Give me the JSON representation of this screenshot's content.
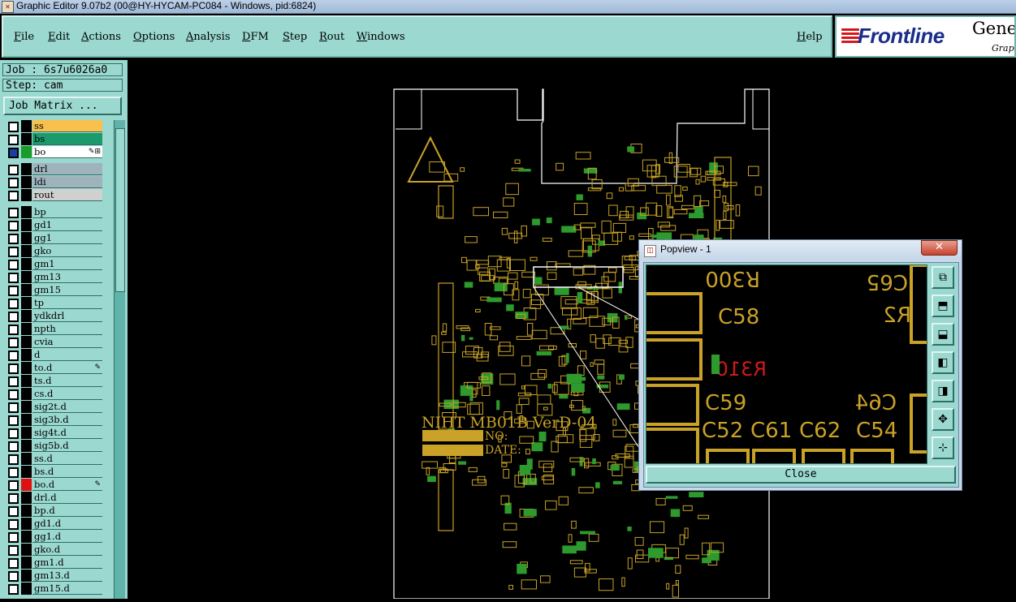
{
  "window": {
    "title": "Graphic Editor 9.07b2 (00@HY-HYCAM-PC084 - Windows, pid:6824)"
  },
  "menu": [
    {
      "label": "File"
    },
    {
      "label": "Edit"
    },
    {
      "label": "Actions"
    },
    {
      "label": "Options"
    },
    {
      "label": "Analysis"
    },
    {
      "label": "DFM"
    },
    {
      "label": "Step"
    },
    {
      "label": "Rout"
    },
    {
      "label": "Windows"
    },
    {
      "label": "Help"
    }
  ],
  "logo": {
    "brand": "Frontline",
    "product_top": "Gene",
    "product_sub": "Grap"
  },
  "job": {
    "job_label": "Job : 6s7u6026a0",
    "step_label": "Step: cam",
    "matrix_button": "Job Matrix ..."
  },
  "layers": [
    {
      "name": "ss",
      "color": "#f9c14c",
      "checked": false,
      "swatch": ""
    },
    {
      "name": "bs",
      "color": "#1c9a6c",
      "checked": false,
      "swatch": ""
    },
    {
      "name": "bo",
      "color": "#ffffff",
      "checked": true,
      "swatch": "#1a9c2a"
    },
    {
      "name": "drl",
      "color": "#9fb3bd",
      "checked": false,
      "swatch": ""
    },
    {
      "name": "ldi",
      "color": "#9fb3bd",
      "checked": false,
      "swatch": ""
    },
    {
      "name": "rout",
      "color": "#d0d0d0",
      "checked": false,
      "swatch": ""
    },
    {
      "name": "bp",
      "color": "#9bd8d0",
      "checked": false,
      "swatch": ""
    },
    {
      "name": "gd1",
      "color": "#9bd8d0",
      "checked": false,
      "swatch": ""
    },
    {
      "name": "gg1",
      "color": "#9bd8d0",
      "checked": false,
      "swatch": ""
    },
    {
      "name": "gko",
      "color": "#9bd8d0",
      "checked": false,
      "swatch": ""
    },
    {
      "name": "gm1",
      "color": "#9bd8d0",
      "checked": false,
      "swatch": ""
    },
    {
      "name": "gm13",
      "color": "#9bd8d0",
      "checked": false,
      "swatch": ""
    },
    {
      "name": "gm15",
      "color": "#9bd8d0",
      "checked": false,
      "swatch": ""
    },
    {
      "name": "tp",
      "color": "#9bd8d0",
      "checked": false,
      "swatch": ""
    },
    {
      "name": "ydkdrl",
      "color": "#9bd8d0",
      "checked": false,
      "swatch": ""
    },
    {
      "name": "npth",
      "color": "#9bd8d0",
      "checked": false,
      "swatch": ""
    },
    {
      "name": "cvia",
      "color": "#9bd8d0",
      "checked": false,
      "swatch": ""
    },
    {
      "name": "d",
      "color": "#9bd8d0",
      "checked": false,
      "swatch": ""
    },
    {
      "name": "to.d",
      "color": "#9bd8d0",
      "checked": false,
      "swatch": ""
    },
    {
      "name": "ts.d",
      "color": "#9bd8d0",
      "checked": false,
      "swatch": ""
    },
    {
      "name": "cs.d",
      "color": "#9bd8d0",
      "checked": false,
      "swatch": ""
    },
    {
      "name": "sig2t.d",
      "color": "#9bd8d0",
      "checked": false,
      "swatch": ""
    },
    {
      "name": "sig3b.d",
      "color": "#9bd8d0",
      "checked": false,
      "swatch": ""
    },
    {
      "name": "sig4t.d",
      "color": "#9bd8d0",
      "checked": false,
      "swatch": ""
    },
    {
      "name": "sig5b.d",
      "color": "#9bd8d0",
      "checked": false,
      "swatch": ""
    },
    {
      "name": "ss.d",
      "color": "#9bd8d0",
      "checked": false,
      "swatch": ""
    },
    {
      "name": "bs.d",
      "color": "#9bd8d0",
      "checked": false,
      "swatch": ""
    },
    {
      "name": "bo.d",
      "color": "#9bd8d0",
      "checked": false,
      "swatch": "#e01010"
    },
    {
      "name": "drl.d",
      "color": "#9bd8d0",
      "checked": false,
      "swatch": ""
    },
    {
      "name": "bp.d",
      "color": "#9bd8d0",
      "checked": false,
      "swatch": ""
    },
    {
      "name": "gd1.d",
      "color": "#9bd8d0",
      "checked": false,
      "swatch": ""
    },
    {
      "name": "gg1.d",
      "color": "#9bd8d0",
      "checked": false,
      "swatch": ""
    },
    {
      "name": "gko.d",
      "color": "#9bd8d0",
      "checked": false,
      "swatch": ""
    },
    {
      "name": "gm1.d",
      "color": "#9bd8d0",
      "checked": false,
      "swatch": ""
    },
    {
      "name": "gm13.d",
      "color": "#9bd8d0",
      "checked": false,
      "swatch": ""
    },
    {
      "name": "gm15.d",
      "color": "#9bd8d0",
      "checked": false,
      "swatch": ""
    }
  ],
  "board": {
    "text_line1": "NIHT MB01B VerD-04",
    "text_no": "NO:",
    "text_date": "DATE:",
    "colors": {
      "silk": "#c9a227",
      "green": "#2e9a2e",
      "outline": "#ffffff"
    }
  },
  "popview": {
    "title": "Popview - 1",
    "close_label": "Close",
    "labels": [
      "R300",
      "C65",
      "C58",
      "R2",
      "R310",
      "C59",
      "C64",
      "C52",
      "C61",
      "C62",
      "C54"
    ],
    "tools": [
      "zoom-fit-icon",
      "pan-up-icon",
      "pan-down-icon",
      "pan-left-icon",
      "pan-right-icon",
      "zoom-in-icon",
      "zoom-out-icon"
    ]
  }
}
